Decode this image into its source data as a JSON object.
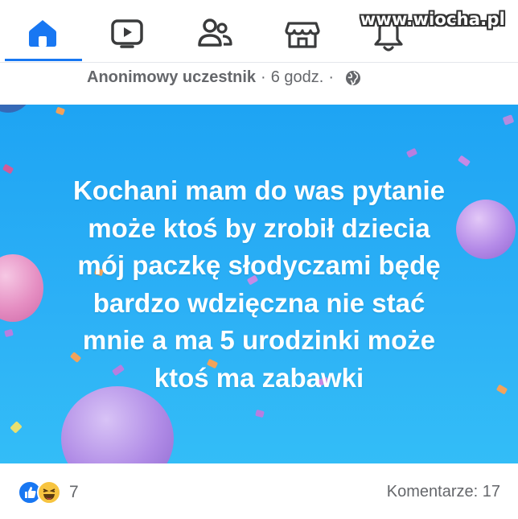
{
  "nav": {
    "items": [
      {
        "name": "home",
        "icon": "home-icon",
        "active": true
      },
      {
        "name": "watch",
        "icon": "video-icon",
        "active": false
      },
      {
        "name": "groups",
        "icon": "people-icon",
        "active": false
      },
      {
        "name": "marketplace",
        "icon": "marketplace-icon",
        "active": false
      },
      {
        "name": "notifications",
        "icon": "bell-icon",
        "active": false
      }
    ],
    "accent_color": "#1877f2"
  },
  "watermark": "www.wiocha.pl",
  "post": {
    "author": "Anonimowy uczestnik",
    "separator1": "·",
    "time": "6 godz.",
    "separator2": "·",
    "privacy_icon": "globe-icon",
    "text": "Kochani mam do was pytanie może ktoś by zrobił dziecia mój paczkę słodyczami będę bardzo wdzięczna nie stać mnie a ma 5 urodzinki może ktoś ma zabawki",
    "text_lines": [
      "Kochani mam do was pytanie",
      "może ktoś by zrobił dziecia",
      "mój paczkę słodyczami będę",
      "bardzo wdzięczna nie stać",
      "mnie a ma 5 urodzinki może",
      "ktoś ma zabawki"
    ],
    "background_color": "#2aaef5"
  },
  "footer": {
    "reactions": [
      "like-icon",
      "haha-icon"
    ],
    "reaction_count": "7",
    "comments_label": "Komentarze: 17"
  }
}
